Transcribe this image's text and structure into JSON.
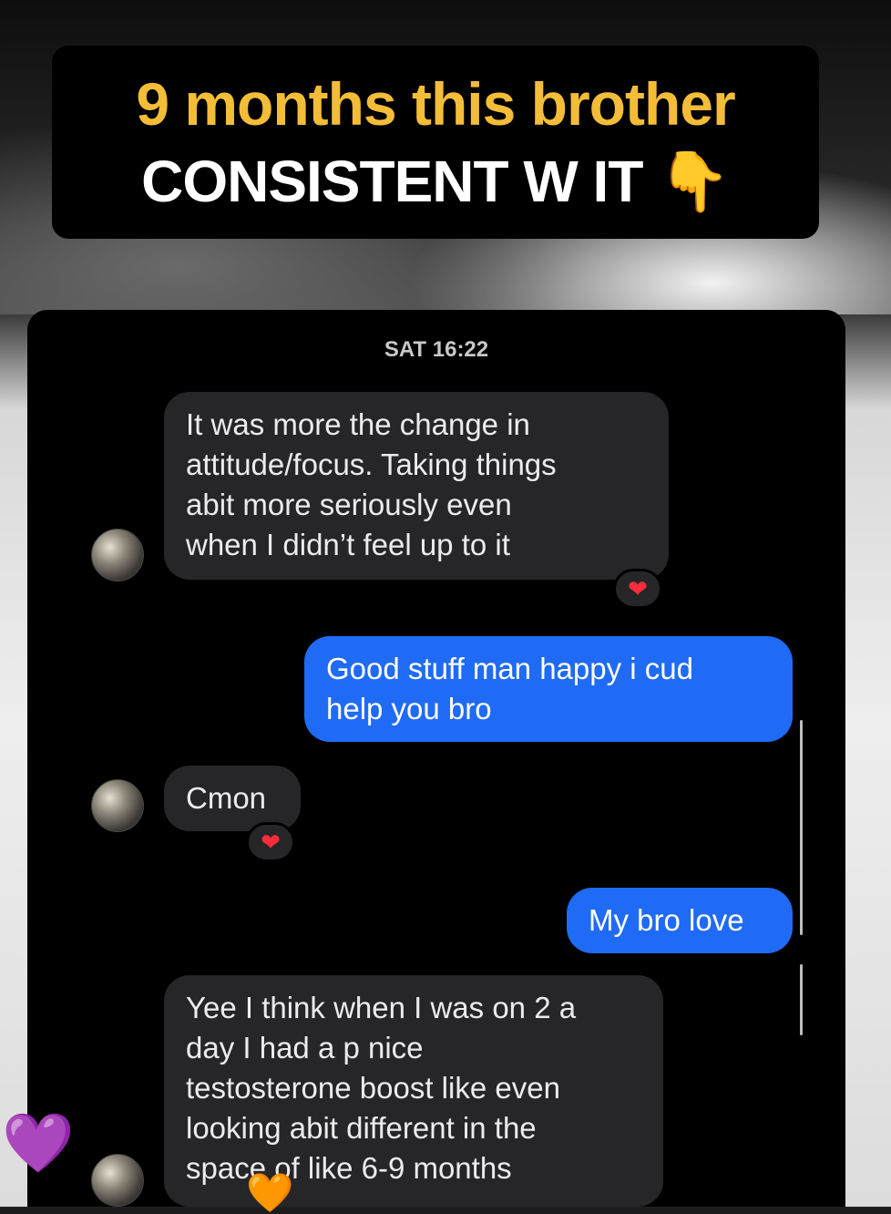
{
  "caption": {
    "line1": "9 months this brother",
    "line2": "CONSISTENT W IT 👇"
  },
  "chat": {
    "timestamp": "SAT 16:22",
    "messages": [
      {
        "sender": "them",
        "text": "It was more the change in\nattitude/focus. Taking things\nabit more seriously even\nwhen I didn’t feel up to it",
        "reaction": "❤"
      },
      {
        "sender": "me",
        "text": "Good stuff man happy i cud\nhelp you bro"
      },
      {
        "sender": "them",
        "text": "Cmon",
        "reaction": "❤"
      },
      {
        "sender": "me",
        "text": "My bro love"
      },
      {
        "sender": "them",
        "text": "Yee I think when I was on 2 a\nday I had a p nice\ntestosterone boost like even\nlooking abit different in the\nspace of like 6-9 months"
      }
    ]
  },
  "overlay": {
    "heart_purple": "💜",
    "heart_orange": "🧡"
  },
  "colors": {
    "caption_yellow": "#f4bd38",
    "outgoing_bubble": "#1f6bf5",
    "incoming_bubble": "#262628",
    "reaction_heart": "#ff2d3a"
  }
}
